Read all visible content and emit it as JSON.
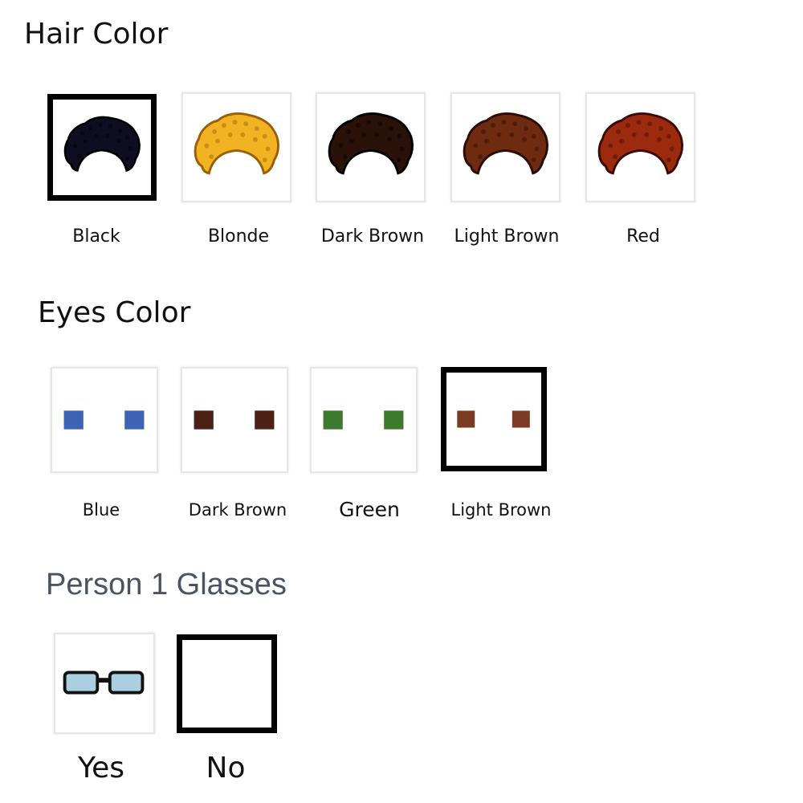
{
  "hair": {
    "title": "Hair Color",
    "options": [
      {
        "label": "Black",
        "color": "#0e0d22",
        "shade": "#000000",
        "selected": true
      },
      {
        "label": "Blonde",
        "color": "#f2b323",
        "shade": "#9a5f08",
        "selected": false
      },
      {
        "label": "Dark Brown",
        "color": "#2a1208",
        "shade": "#000000",
        "selected": false
      },
      {
        "label": "Light Brown",
        "color": "#6e2b12",
        "shade": "#2a0d04",
        "selected": false
      },
      {
        "label": "Red",
        "color": "#9b2a0e",
        "shade": "#3c0a02",
        "selected": false
      }
    ]
  },
  "eyes": {
    "title": "Eyes Color",
    "options": [
      {
        "label": "Blue",
        "color": "#3f63b4",
        "selected": false
      },
      {
        "label": "Dark Brown",
        "color": "#4b2116",
        "selected": false
      },
      {
        "label": "Green",
        "color": "#3d7a2c",
        "selected": false
      },
      {
        "label": "Light Brown",
        "color": "#7b3a22",
        "selected": true
      }
    ]
  },
  "glasses": {
    "title": "Person 1 Glasses",
    "options": [
      {
        "label": "Yes",
        "lens_color": "#a9cfe0",
        "selected": false
      },
      {
        "label": "No",
        "selected": true
      }
    ]
  }
}
